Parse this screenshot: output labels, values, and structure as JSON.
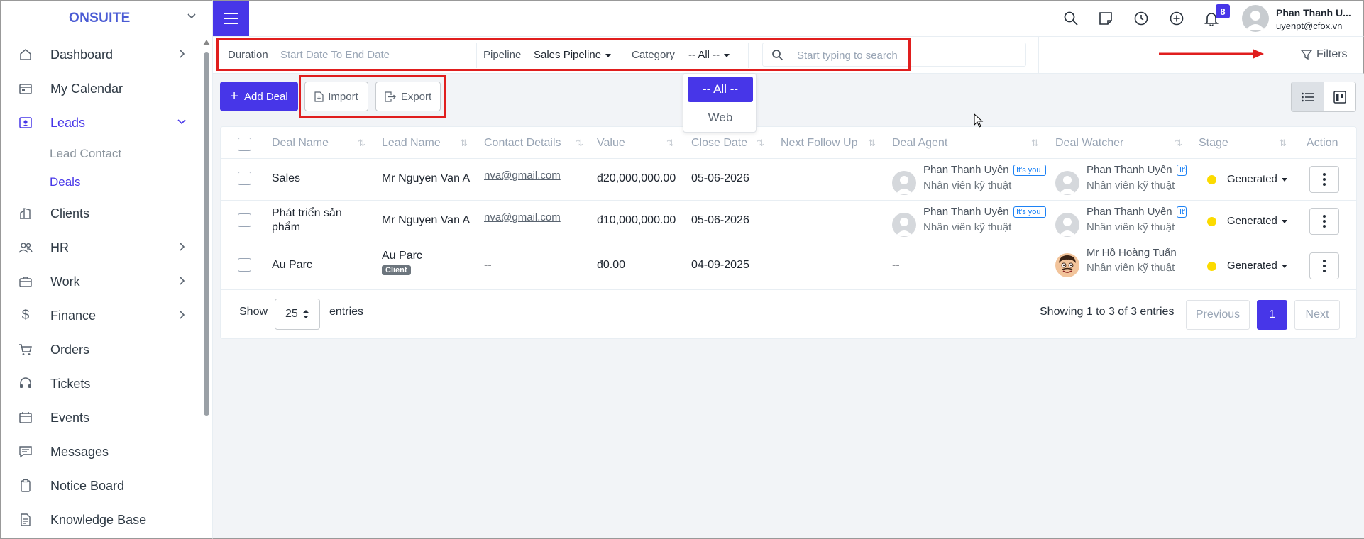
{
  "brand": "ONSUITE",
  "sidebar": {
    "items": [
      {
        "label": "Dashboard"
      },
      {
        "label": "My Calendar"
      },
      {
        "label": "Leads"
      },
      {
        "label": "Lead Contact"
      },
      {
        "label": "Deals"
      },
      {
        "label": "Clients"
      },
      {
        "label": "HR"
      },
      {
        "label": "Work"
      },
      {
        "label": "Finance"
      },
      {
        "label": "Orders"
      },
      {
        "label": "Tickets"
      },
      {
        "label": "Events"
      },
      {
        "label": "Messages"
      },
      {
        "label": "Notice Board"
      },
      {
        "label": "Knowledge Base"
      }
    ]
  },
  "topbar": {
    "notification_count": "8",
    "user_name": "Phan Thanh U...",
    "user_email": "uyenpt@cfox.vn"
  },
  "filters": {
    "duration_label": "Duration",
    "duration_placeholder": "Start Date To End Date",
    "pipeline_label": "Pipeline",
    "pipeline_value": "Sales Pipeline",
    "category_label": "Category",
    "category_value": "-- All --",
    "search_placeholder": "Start typing to search",
    "filters_label": "Filters"
  },
  "category_dropdown": {
    "options": [
      "-- All --",
      "Web"
    ],
    "selected": "-- All --"
  },
  "actions": {
    "add_deal": "Add Deal",
    "import": "Import",
    "export": "Export"
  },
  "table": {
    "columns": [
      "Deal Name",
      "Lead Name",
      "Contact Details",
      "Value",
      "Close Date",
      "Next Follow Up",
      "Deal Agent",
      "Deal Watcher",
      "Stage",
      "Action"
    ],
    "rows": [
      {
        "deal_name": "Sales",
        "lead_name": "Mr Nguyen Van A",
        "contact": "nva@gmail.com",
        "value": "đ20,000,000.00",
        "close_date": "05-06-2026",
        "agent_name": "Phan Thanh Uyên",
        "agent_role": "Nhân viên kỹ thuật",
        "agent_badge": "It's you",
        "watcher_name": "Phan Thanh Uyên",
        "watcher_role": "Nhân viên kỹ thuật",
        "watcher_badge": "It's you",
        "stage": "Generated"
      },
      {
        "deal_name_line1": "Phát triển sản",
        "deal_name_line2": "phẩm",
        "lead_name": "Mr Nguyen Van A",
        "contact": "nva@gmail.com",
        "value": "đ10,000,000.00",
        "close_date": "05-06-2026",
        "agent_name": "Phan Thanh Uyên",
        "agent_role": "Nhân viên kỹ thuật",
        "agent_badge": "It's you",
        "watcher_name": "Phan Thanh Uyên",
        "watcher_role": "Nhân viên kỹ thuật",
        "watcher_badge": "It's you",
        "stage": "Generated"
      },
      {
        "deal_name": "Au Parc",
        "lead_name": "Au Parc",
        "lead_badge": "Client",
        "contact": "--",
        "value": "đ0.00",
        "close_date": "04-09-2025",
        "agent_name": "--",
        "watcher_name": "Mr Hồ Hoàng Tuấn",
        "watcher_role": "Nhân viên kỹ thuật",
        "stage": "Generated"
      }
    ]
  },
  "footer": {
    "show": "Show",
    "page_size": "25",
    "entries": "entries",
    "info": "Showing 1 to 3 of 3 entries",
    "previous": "Previous",
    "current_page": "1",
    "next": "Next"
  },
  "colors": {
    "primary": "#4736e8",
    "highlight_red": "#e01e1e",
    "stage_yellow": "#fcdb00"
  }
}
